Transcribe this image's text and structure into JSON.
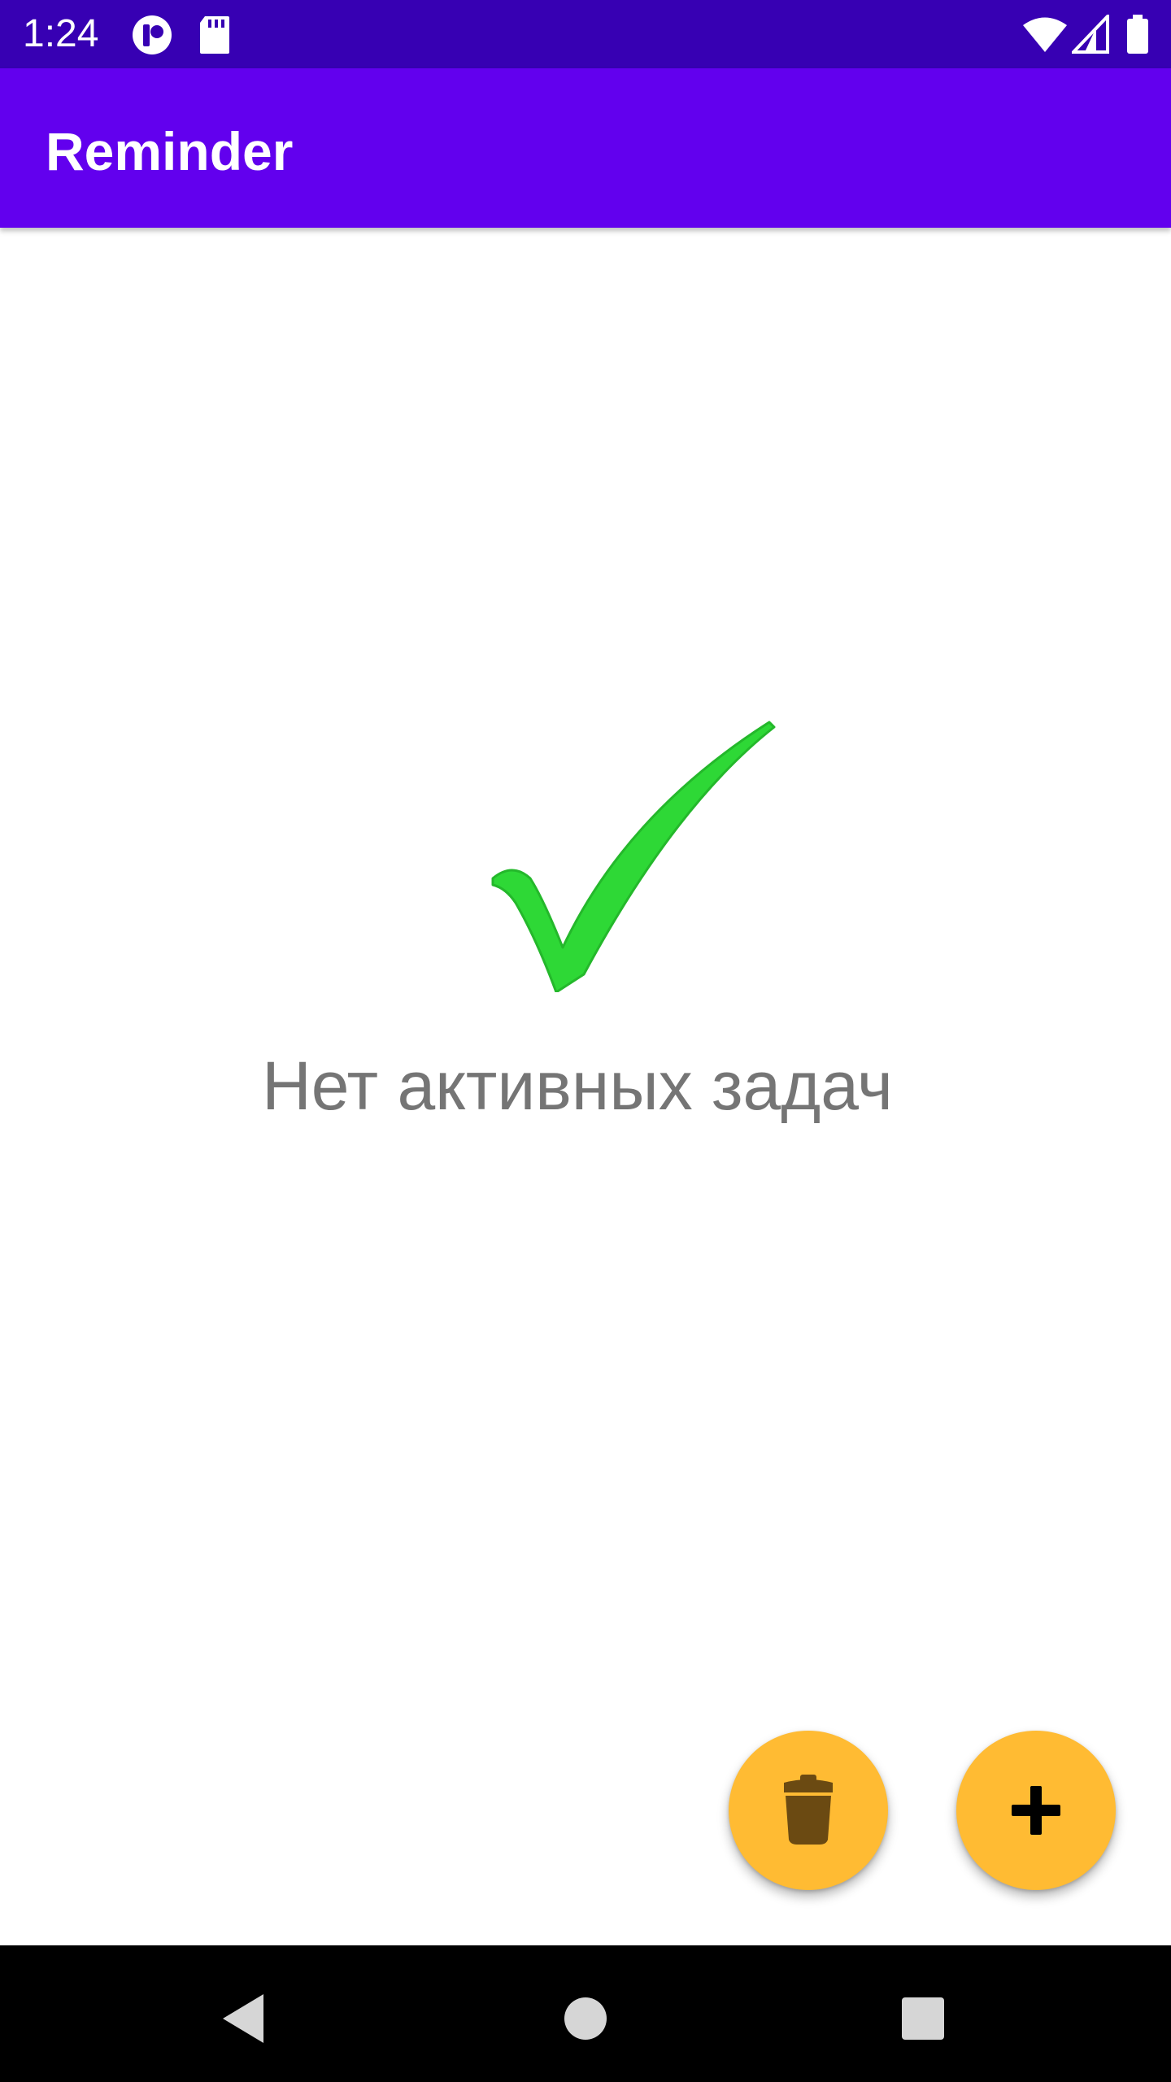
{
  "status_bar": {
    "time": "1:24",
    "icons": [
      "notification-app-icon",
      "sd-card-icon",
      "wifi-icon",
      "signal-icon",
      "battery-icon"
    ]
  },
  "app_bar": {
    "title": "Reminder"
  },
  "empty_state": {
    "icon": "checkmark-icon",
    "message": "Нет активных задач"
  },
  "fabs": {
    "delete_icon": "trash-icon",
    "add_icon": "plus-icon"
  },
  "nav_bar": {
    "icons": [
      "back-icon",
      "home-icon",
      "recents-icon"
    ]
  },
  "colors": {
    "status_bar": "#3700b3",
    "app_bar": "#6200ee",
    "fab": "#ffbb33",
    "check": "#2ed836",
    "empty_text": "#757575"
  }
}
